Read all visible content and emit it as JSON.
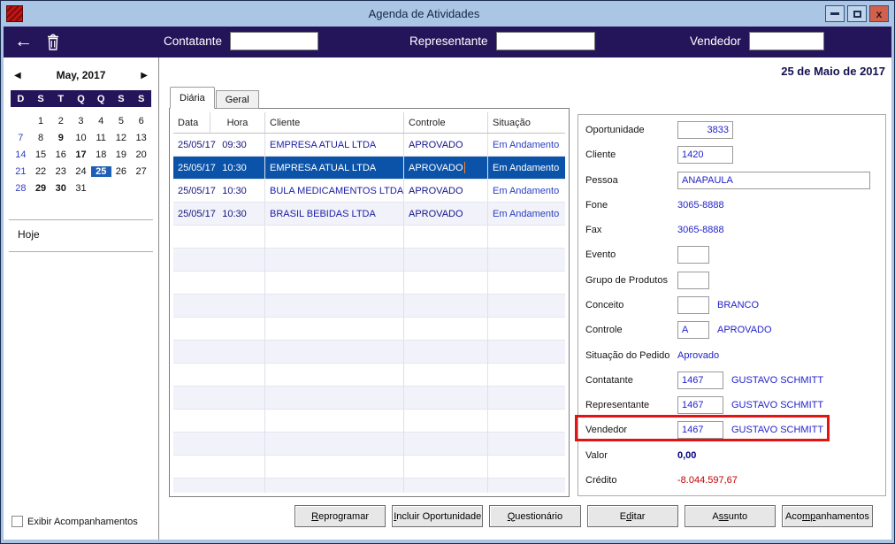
{
  "window": {
    "title": "Agenda de Atividades"
  },
  "icons": {
    "back_glyph": "←",
    "close_glyph": "x",
    "prev_glyph": "◀",
    "next_glyph": "▶"
  },
  "toolbar": {
    "fields": [
      {
        "label": "Contatante",
        "value": ""
      },
      {
        "label": "Representante",
        "value": ""
      },
      {
        "label": "Vendedor",
        "value": ""
      }
    ]
  },
  "date_heading": "25 de Maio de 2017",
  "calendar": {
    "title": "May, 2017",
    "day_headers": [
      "D",
      "S",
      "T",
      "Q",
      "Q",
      "S",
      "S"
    ],
    "weeks": [
      [
        "",
        "1",
        "2",
        "3",
        "4",
        "5",
        "6"
      ],
      [
        "7",
        "8",
        "9",
        "10",
        "11",
        "12",
        "13"
      ],
      [
        "14",
        "15",
        "16",
        "17",
        "18",
        "19",
        "20"
      ],
      [
        "21",
        "22",
        "23",
        "24",
        "25",
        "26",
        "27"
      ],
      [
        "28",
        "29",
        "30",
        "31",
        "",
        "",
        ""
      ]
    ],
    "bold_days": [
      "9",
      "17",
      "29",
      "30"
    ],
    "selected_day": "25",
    "today_label": "Hoje"
  },
  "left_footer": {
    "checkbox_label": "Exibir Acompanhamentos",
    "checked": false
  },
  "tabs": [
    {
      "label": "Diária",
      "active": true
    },
    {
      "label": "Geral",
      "active": false
    }
  ],
  "table": {
    "columns": [
      "Data",
      "Hora",
      "Cliente",
      "Controle",
      "Situação"
    ],
    "rows": [
      {
        "data": "25/05/17",
        "hora": "09:30",
        "cliente": "EMPRESA ATUAL LTDA",
        "controle": "APROVADO",
        "situacao": "Em Andamento",
        "selected": false
      },
      {
        "data": "25/05/17",
        "hora": "10:30",
        "cliente": "EMPRESA ATUAL LTDA",
        "controle": "APROVADO",
        "situacao": "Em Andamento",
        "selected": true
      },
      {
        "data": "25/05/17",
        "hora": "10:30",
        "cliente": "BULA MEDICAMENTOS LTDA",
        "controle": "APROVADO",
        "situacao": "Em Andamento",
        "selected": false
      },
      {
        "data": "25/05/17",
        "hora": "10:30",
        "cliente": "BRASIL BEBIDAS LTDA",
        "controle": "APROVADO",
        "situacao": "Em Andamento",
        "selected": false
      }
    ]
  },
  "details": {
    "oportunidade": {
      "label": "Oportunidade",
      "value": "3833"
    },
    "cliente": {
      "label": "Cliente",
      "value": "1420"
    },
    "pessoa": {
      "label": "Pessoa",
      "value": "ANAPAULA"
    },
    "fone": {
      "label": "Fone",
      "value": "3065-8888"
    },
    "fax": {
      "label": "Fax",
      "value": "3065-8888"
    },
    "evento": {
      "label": "Evento",
      "value": ""
    },
    "grupo_produtos": {
      "label": "Grupo de Produtos",
      "value": ""
    },
    "conceito": {
      "label": "Conceito",
      "value": "",
      "description": "BRANCO"
    },
    "controle": {
      "label": "Controle",
      "value": "A",
      "description": "APROVADO"
    },
    "situacao_pedido": {
      "label": "Situação do Pedido",
      "value": "Aprovado"
    },
    "contatante": {
      "label": "Contatante",
      "value": "1467",
      "description": "GUSTAVO SCHMITT"
    },
    "representante": {
      "label": "Representante",
      "value": "1467",
      "description": "GUSTAVO SCHMITT"
    },
    "vendedor": {
      "label": "Vendedor",
      "value": "1467",
      "description": "GUSTAVO SCHMITT",
      "highlighted": true
    },
    "valor": {
      "label": "Valor",
      "value": "0,00"
    },
    "credito": {
      "label": "Crédito",
      "value": "-8.044.597,67"
    }
  },
  "footer_buttons": [
    {
      "pre": "",
      "u": "R",
      "post": "eprogramar"
    },
    {
      "pre": "",
      "u": "I",
      "post": "ncluir Oportunidade"
    },
    {
      "pre": "",
      "u": "Q",
      "post": "uestionário"
    },
    {
      "pre": "E",
      "u": "d",
      "post": "itar"
    },
    {
      "pre": "A",
      "u": "ss",
      "post": "unto"
    },
    {
      "pre": "Aco",
      "u": "mp",
      "post": "anhamentos"
    }
  ],
  "colors": {
    "titlebar": "#abc6e5",
    "toolbar": "#241459",
    "selection_blue": "#0b53a9",
    "row_stripe": "#f2f3fa",
    "highlight_red": "#e11313",
    "value_blue": "#2222cc",
    "valor_navy": "#00007e",
    "credit_red": "#c00000",
    "calendar_selected": "#1d5fb5",
    "close_button": "#d2604c"
  }
}
